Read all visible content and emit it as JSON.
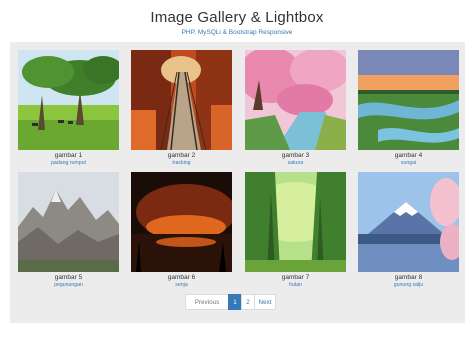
{
  "header": {
    "title": "Image Gallery & Lightbox",
    "subtitle": "PHP, MySQLi & Bootstrap Responsive"
  },
  "gallery": [
    {
      "name": "gambar 1",
      "desc": "padang rumput"
    },
    {
      "name": "gambar 2",
      "desc": "tracking"
    },
    {
      "name": "gambar 3",
      "desc": "sakura"
    },
    {
      "name": "gambar 4",
      "desc": "sungai"
    },
    {
      "name": "gambar 5",
      "desc": "pegunungan"
    },
    {
      "name": "gambar 6",
      "desc": "senja"
    },
    {
      "name": "gambar 7",
      "desc": "hutan"
    },
    {
      "name": "gambar 8",
      "desc": "gunung salju"
    }
  ],
  "pagination": {
    "previous": "Previous",
    "pages": [
      "1",
      "2"
    ],
    "active_page": "1",
    "next": "Next"
  },
  "colors": {
    "link": "#337ab7",
    "panel_bg": "#ececec",
    "active_page_bg": "#337ab7"
  },
  "icons": []
}
